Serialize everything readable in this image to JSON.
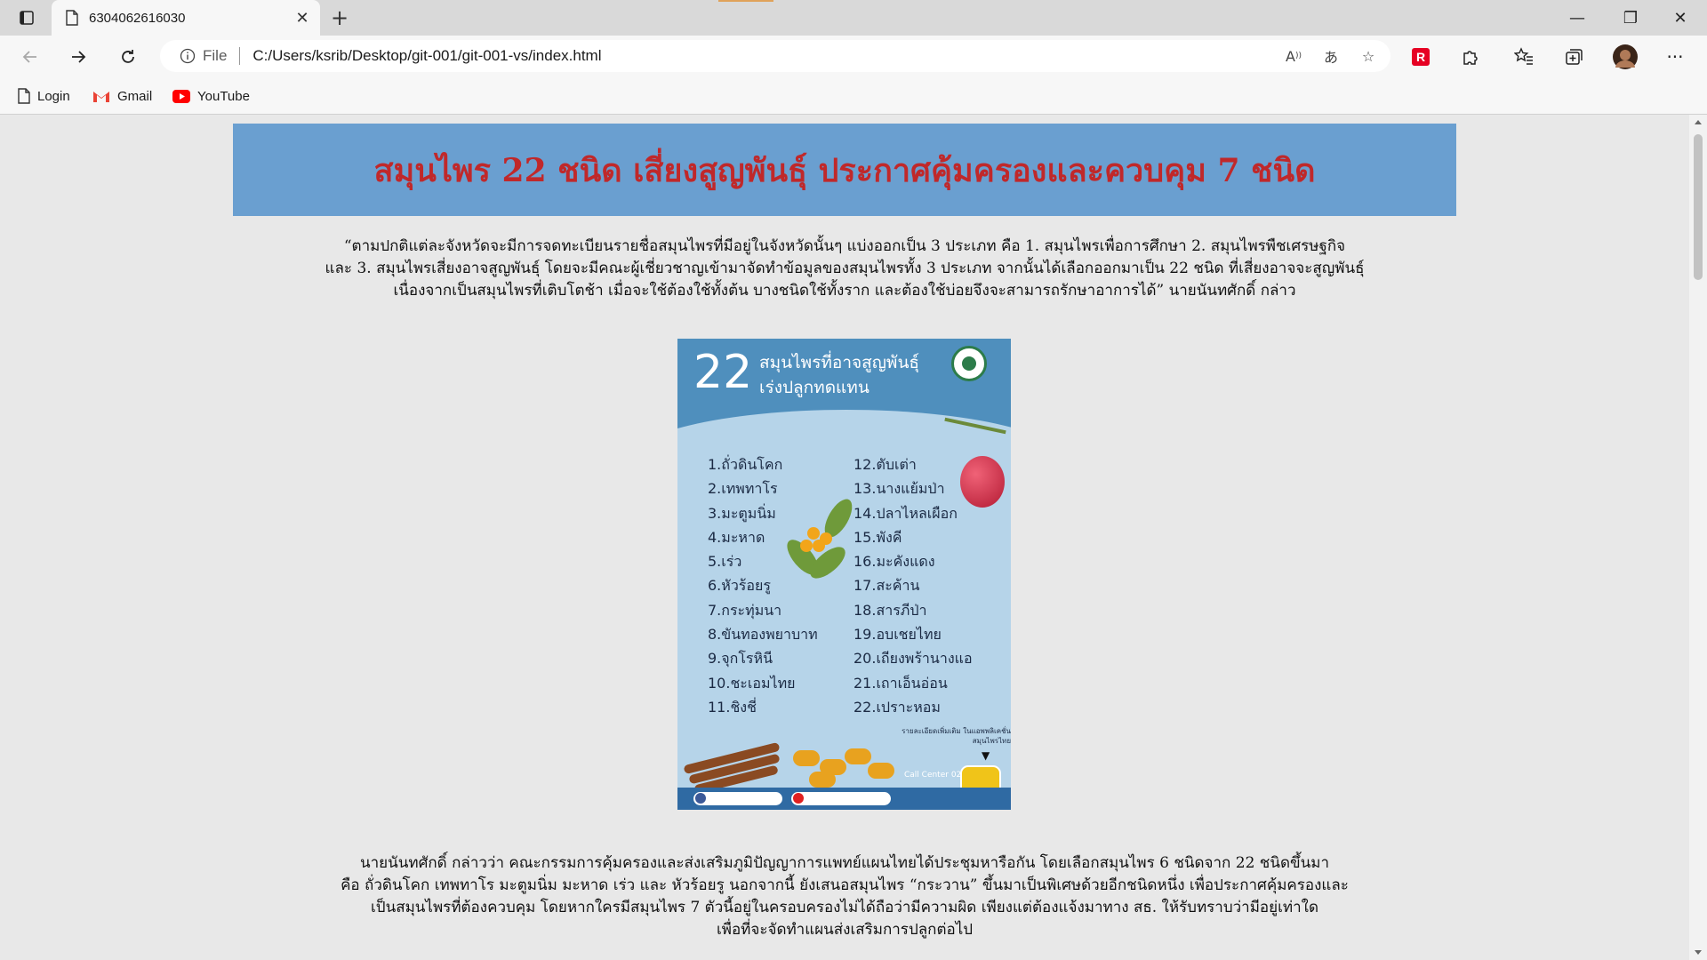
{
  "browser": {
    "tab": {
      "title": "6304062616030",
      "close": "✕"
    },
    "new_tab": "+",
    "window_controls": {
      "minimize": "—",
      "restore": "❐",
      "close": "✕"
    },
    "address": {
      "scheme_label": "File",
      "url": "C:/Users/ksrib/Desktop/git-001/git-001-vs/index.html"
    },
    "bookmarks": [
      {
        "label": "Login",
        "icon": "page-icon"
      },
      {
        "label": "Gmail",
        "icon": "gmail-icon"
      },
      {
        "label": "YouTube",
        "icon": "youtube-icon"
      }
    ],
    "colors": {
      "accent_red": "#e60023",
      "loading": "#e0a25a"
    }
  },
  "page": {
    "heading": "สมุนไพร 22 ชนิด เสี่ยงสูญพันธุ์ ประกาศคุ้มครองและควบคุม 7 ชนิด",
    "paragraph1": [
      "“ตามปกติแต่ละจังหวัดจะมีการจดทะเบียนรายชื่อสมุนไพรที่มีอยู่ในจังหวัดนั้นๆ แบ่งออกเป็น 3 ประเภท คือ 1. สมุนไพรเพื่อการศึกษา 2. สมุนไพรพืชเศรษฐกิจ",
      "และ 3. สมุนไพรเสี่ยงอาจสูญพันธุ์ โดยจะมีคณะผู้เชี่ยวชาญเข้ามาจัดทำข้อมูลของสมุนไพรทั้ง 3 ประเภท จากนั้นได้เลือกออกมาเป็น 22 ชนิด ที่เสี่ยงอาจจะสูญพันธุ์",
      "เนื่องจากเป็นสมุนไพรที่เติบโตช้า เมื่อจะใช้ต้องใช้ทั้งต้น บางชนิดใช้ทั้งราก และต้องใช้บ่อยจึงจะสามารถรักษาอาการได้” นายนันทศักดิ์ กล่าว"
    ],
    "paragraph2": [
      "นายนันทศักดิ์ กล่าวว่า คณะกรรมการคุ้มครองและส่งเสริมภูมิปัญญาการแพทย์แผนไทยได้ประชุมหารือกัน โดยเลือกสมุนไพร 6 ชนิดจาก 22 ชนิดขึ้นมา",
      "คือ ถั่วดินโคก เทพทาโร มะตูมนิ่ม มะหาด เร่ว และ หัวร้อยรู นอกจากนี้ ยังเสนอสมุนไพร “กระวาน” ขึ้นมาเป็นพิเศษด้วยอีกชนิดหนึ่ง เพื่อประกาศคุ้มครองและ",
      "เป็นสมุนไพรที่ต้องควบคุม โดยหากใครมีสมุนไพร 7 ตัวนี้อยู่ในครอบครองไม่ได้ถือว่ามีความผิด เพียงแต่ต้องแจ้งมาทาง สธ. ให้รับทราบว่ามีอยู่เท่าใด",
      "เพื่อที่จะจัดทำแผนส่งเสริมการปลูกต่อไป"
    ],
    "poster": {
      "number": "22",
      "headline1": "สมุนไพรที่อาจสูญพันธุ์",
      "headline2": "เร่งปลูกทดแทน",
      "list_left": [
        "1.ถั่วดินโคก",
        "2.เทพทาโร",
        "3.มะตูมนิ่ม",
        "4.มะหาด",
        "5.เร่ว",
        "6.หัวร้อยรู",
        "7.กระทุ่มนา",
        "8.ขันทองพยาบาท",
        "9.จุกโรหินี",
        "10.ชะเอมไทย",
        "11.ชิงชี่"
      ],
      "list_right": [
        "12.ตับเต่า",
        "13.นางแย้มป่า",
        "14.ปลาไหลเผือก",
        "15.พังคี",
        "16.มะคังแดง",
        "17.สะค้าน",
        "18.สารภีป่า",
        "19.อบเชยไทย",
        "20.เถียงพร้านางแอ",
        "21.เถาเอ็นอ่อน",
        "22.เปราะหอม"
      ],
      "note": "รายละเอียดเพิ่มเติม ในแอพพลิเคชั่นสมุนไพรไทย",
      "call_center": "Call Center 02-5917007"
    }
  }
}
